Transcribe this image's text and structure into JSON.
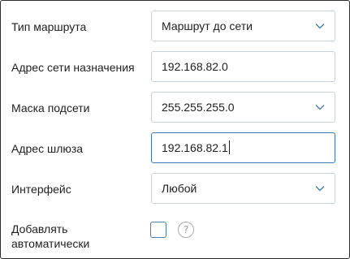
{
  "form": {
    "route_type": {
      "label": "Тип маршрута",
      "value": "Маршрут до сети",
      "icon": "chevron-down-icon"
    },
    "destination_network": {
      "label": "Адрес сети назначения",
      "value": "192.168.82.0"
    },
    "subnet_mask": {
      "label": "Маска подсети",
      "value": "255.255.255.0",
      "icon": "chevron-down-icon"
    },
    "gateway": {
      "label": "Адрес шлюза",
      "value": "192.168.82.1",
      "focused": true
    },
    "interface": {
      "label": "Интерфейс",
      "value": "Любой",
      "icon": "chevron-down-icon"
    },
    "auto_add": {
      "label_line1": "Добавлять",
      "label_line2": "автоматически",
      "checked": false,
      "help_glyph": "?"
    }
  },
  "colors": {
    "field_border": "#c9d2dc",
    "focus_border": "#3b78b7",
    "checkbox_border": "#4a7fb3",
    "chevron": "#4a7fb3",
    "frame_border": "#2b2b2b"
  }
}
